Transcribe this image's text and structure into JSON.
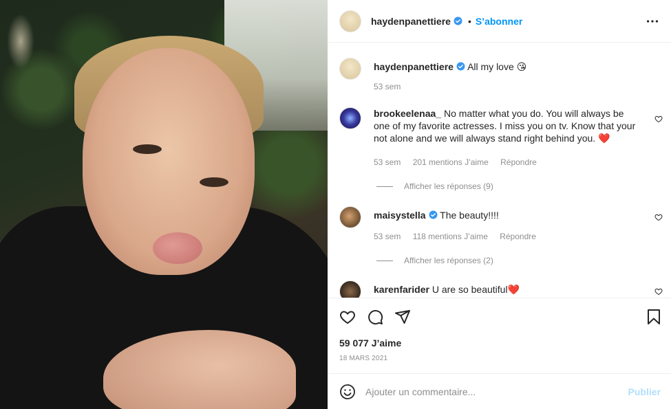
{
  "post": {
    "author": "haydenpanettiere",
    "follow_label": "S’abonner",
    "dot": "•",
    "caption": {
      "username": "haydenpanettiere",
      "text": "All my love 😘",
      "time": "53 sem"
    },
    "likes": "59 077 J’aime",
    "date": "18 MARS 2021"
  },
  "comments": [
    {
      "username": "brookeelenaa_",
      "text": "No matter what you do. You will always be one of my favorite actresses. I miss you on tv. Know that your not alone and we will always stand right behind you. ❤️",
      "time": "53 sem",
      "likes": "201 mentions J’aime",
      "reply": "Répondre",
      "view_replies": "Afficher les réponses (9)"
    },
    {
      "username": "maisystella",
      "text": "The beauty!!!!",
      "time": "53 sem",
      "likes": "118 mentions J’aime",
      "reply": "Répondre",
      "view_replies": "Afficher les réponses (2)"
    },
    {
      "username": "karenfarider",
      "text": "U are so beautiful❤️"
    }
  ],
  "composer": {
    "placeholder": "Ajouter un commentaire...",
    "publish_label": "Publier"
  },
  "colors": {
    "link": "#0095f6",
    "verified": "#3897f0",
    "muted": "#8e8e8e",
    "publish_disabled": "#b2dffc"
  },
  "icons": [
    "verified-badge-icon",
    "more-icon",
    "heart-icon",
    "comment-icon",
    "share-icon",
    "bookmark-icon",
    "emoji-icon"
  ]
}
